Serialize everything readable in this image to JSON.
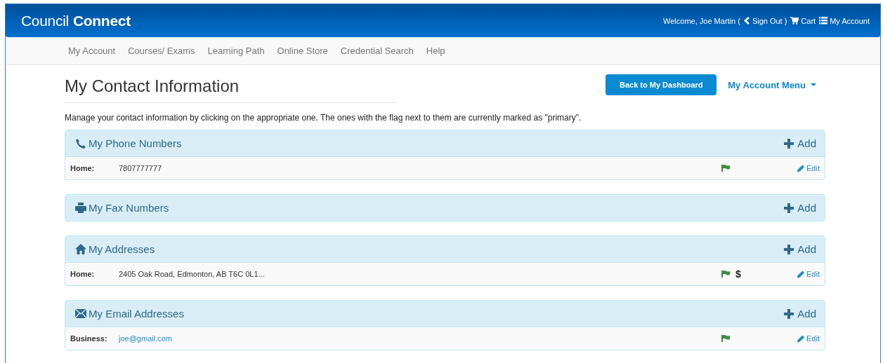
{
  "header": {
    "logo_light": "Council",
    "logo_bold": "Connect",
    "welcome": "Welcome, Joe Martin (",
    "sign_out": "Sign Out",
    "close_paren": ")",
    "cart": "Cart",
    "account": "My Account"
  },
  "nav": [
    "My Account",
    "Courses/ Exams",
    "Learning Path",
    "Online Store",
    "Credential Search",
    "Help"
  ],
  "page": {
    "title": "My Contact Information",
    "back_button": "Back to My Dashboard",
    "account_menu": "My Account Menu",
    "description": "Manage your contact information by clicking on the appropriate one. The ones with the flag next to them are currently marked as \"primary\"."
  },
  "panels": [
    {
      "kind": "phone",
      "title": "My Phone Numbers",
      "add": "Add",
      "entries": [
        {
          "label": "Home:",
          "value": "7807777777",
          "kind": "text",
          "primary": true,
          "edit": "Edit"
        }
      ]
    },
    {
      "kind": "fax",
      "title": "My Fax Numbers",
      "add": "Add"
    },
    {
      "kind": "home",
      "title": "My Addresses",
      "add": "Add",
      "entries": [
        {
          "label": "Home:",
          "value": "2405 Oak Road, Edmonton, AB T6C 0L1...",
          "kind": "text",
          "primary": true,
          "billing": "$",
          "edit": "Edit"
        }
      ]
    },
    {
      "kind": "email",
      "title": "My Email Addresses",
      "add": "Add",
      "entries": [
        {
          "label": "Business:",
          "value": "joe@gmail.com",
          "kind": "link",
          "primary": true,
          "edit": "Edit"
        }
      ]
    }
  ]
}
